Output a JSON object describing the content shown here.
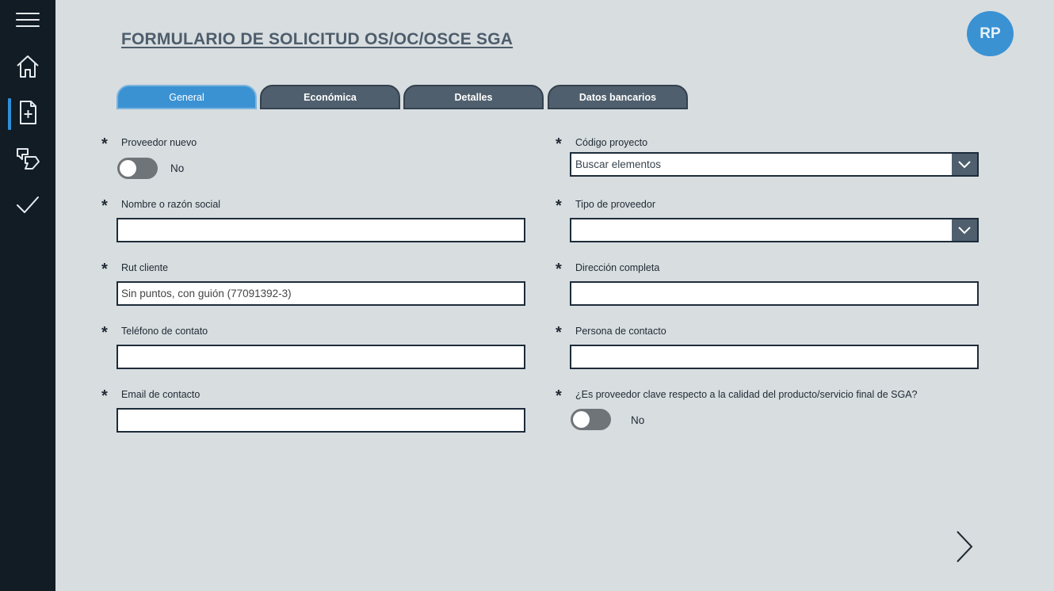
{
  "sidebar": {
    "items": [
      {
        "icon": "menu-icon"
      },
      {
        "icon": "home-icon"
      },
      {
        "icon": "new-document-icon",
        "active": true
      },
      {
        "icon": "approvals-icon"
      },
      {
        "icon": "checkmark-icon"
      }
    ],
    "accent": "#2f8fd8"
  },
  "header": {
    "title": "FORMULARIO DE SOLICITUD OS/OC/OSCE SGA",
    "avatar_initials": "RP"
  },
  "tabs": [
    {
      "label": "General",
      "active": true
    },
    {
      "label": "Económica",
      "active": false
    },
    {
      "label": "Detalles",
      "active": false
    },
    {
      "label": "Datos bancarios",
      "active": false
    }
  ],
  "form": {
    "required_marker": "*",
    "left": {
      "proveedor_nuevo": {
        "label": "Proveedor nuevo",
        "value": "No"
      },
      "nombre": {
        "label": "Nombre o razón social",
        "value": "",
        "placeholder": ""
      },
      "rut": {
        "label": "Rut cliente",
        "value": "",
        "placeholder": "Sin puntos, con guión (77091392-3)"
      },
      "telefono": {
        "label": "Teléfono de contato",
        "value": "",
        "placeholder": ""
      },
      "email": {
        "label": "Email de contacto",
        "value": "",
        "placeholder": ""
      }
    },
    "right": {
      "codigo_proyecto": {
        "label": "Código proyecto",
        "value": "Buscar elementos"
      },
      "tipo_proveedor": {
        "label": "Tipo de proveedor",
        "value": ""
      },
      "direccion": {
        "label": "Dirección completa",
        "value": "",
        "placeholder": ""
      },
      "persona_contacto": {
        "label": "Persona de contacto",
        "value": "",
        "placeholder": ""
      },
      "proveedor_clave": {
        "label": "¿Es proveedor clave respecto a la calidad del producto/servicio final de SGA?",
        "value": "No"
      }
    }
  },
  "navigation": {
    "next_icon": "chevron-right-icon"
  },
  "colors": {
    "background": "#d8dde0",
    "sidebar": "#111c25",
    "tab_active": "#3a92d3",
    "tab_inactive": "#4f5f6d",
    "avatar": "#3a92d3"
  }
}
